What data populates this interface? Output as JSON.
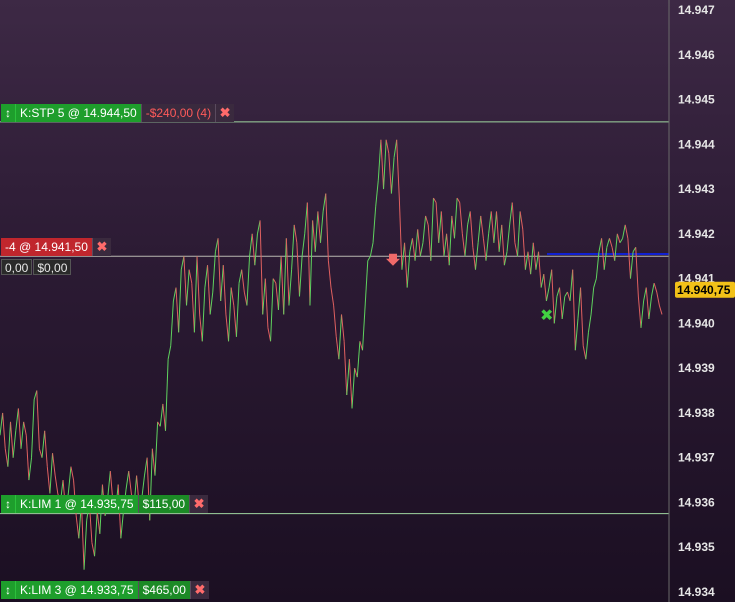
{
  "chart_data": {
    "type": "line",
    "y_axis": {
      "ylim": [
        14.9336,
        14.9473
      ],
      "ticks": [
        "14.947",
        "14.946",
        "14.945",
        "14.944",
        "14.943",
        "14.942",
        "14.941",
        "14.940",
        "14.939",
        "14.938",
        "14.937",
        "14.936",
        "14.935",
        "14.934"
      ]
    },
    "last_price": "14.940,75",
    "series": [
      {
        "values": [
          14.9375,
          14.938,
          14.9372,
          14.9368,
          14.9378,
          14.937,
          14.9376,
          14.9381,
          14.9372,
          14.9378,
          14.9375,
          14.9365,
          14.937,
          14.9383,
          14.9385,
          14.9372,
          14.937,
          14.9376,
          14.9368,
          14.9362,
          14.9371,
          14.9366,
          14.9362,
          14.936,
          14.9365,
          14.9358,
          14.9362,
          14.9368,
          14.9365,
          14.9357,
          14.9352,
          14.936,
          14.9345,
          14.9356,
          14.936,
          14.9351,
          14.9348,
          14.9358,
          14.9353,
          14.9364,
          14.9357,
          14.9361,
          14.9367,
          14.936,
          14.9358,
          14.9364,
          14.9352,
          14.9358,
          14.9363,
          14.9367,
          14.9362,
          14.9359,
          14.9366,
          14.9359,
          14.9361,
          14.9366,
          14.937,
          14.9356,
          14.9372,
          14.9366,
          14.9378,
          14.9377,
          14.9382,
          14.9376,
          14.9392,
          14.9395,
          14.9405,
          14.9408,
          14.9398,
          14.9412,
          14.9415,
          14.9404,
          14.9412,
          14.9409,
          14.9398,
          14.9415,
          14.9402,
          14.9396,
          14.9408,
          14.9413,
          14.9402,
          14.9407,
          14.9416,
          14.9419,
          14.9405,
          14.9413,
          14.9402,
          14.9396,
          14.9408,
          14.9404,
          14.9397,
          14.9409,
          14.9412,
          14.9407,
          14.9404,
          14.9415,
          14.942,
          14.9413,
          14.942,
          14.9423,
          14.9402,
          14.941,
          14.9399,
          14.9396,
          14.941,
          14.9409,
          14.9403,
          14.9415,
          14.9402,
          14.9419,
          14.9404,
          14.9412,
          14.9422,
          14.9418,
          14.9406,
          14.9415,
          14.942,
          14.9427,
          14.9404,
          14.9423,
          14.9416,
          14.9425,
          14.9418,
          14.9425,
          14.9429,
          14.9414,
          14.9408,
          14.9404,
          14.9397,
          14.9392,
          14.9402,
          14.9396,
          14.9384,
          14.9392,
          14.9381,
          14.939,
          14.9388,
          14.9396,
          14.9394,
          14.9404,
          14.9414,
          14.9415,
          14.9418,
          14.9426,
          14.9432,
          14.9441,
          14.943,
          14.9441,
          14.9438,
          14.9429,
          14.9437,
          14.9441,
          14.9428,
          14.9412,
          14.9418,
          14.9408,
          14.9416,
          14.9419,
          14.9414,
          14.9421,
          14.9415,
          14.9418,
          14.9424,
          14.9422,
          14.9414,
          14.9428,
          14.9427,
          14.9418,
          14.9425,
          14.9415,
          14.942,
          14.9413,
          14.9424,
          14.9419,
          14.9428,
          14.9427,
          14.942,
          14.9415,
          14.9422,
          14.9425,
          14.9417,
          14.9412,
          14.9418,
          14.9424,
          14.9419,
          14.9414,
          14.942,
          14.9425,
          14.9418,
          14.9425,
          14.9416,
          14.9422,
          14.9413,
          14.9416,
          14.9422,
          14.9427,
          14.9418,
          14.9415,
          14.9425,
          14.9421,
          14.9412,
          14.9416,
          14.9411,
          14.9418,
          14.9412,
          14.9416,
          14.9408,
          14.9411,
          14.9405,
          14.9408,
          14.9412,
          14.94,
          14.9406,
          14.9408,
          14.9401,
          14.9406,
          14.9407,
          14.9405,
          14.9412,
          14.9394,
          14.9401,
          14.9408,
          14.9395,
          14.9392,
          14.9398,
          14.9402,
          14.9408,
          14.941,
          14.9416,
          14.9419,
          14.9412,
          14.9417,
          14.9419,
          14.9417,
          14.9414,
          14.942,
          14.9418,
          14.9419,
          14.9422,
          14.9419,
          14.941,
          14.9416,
          14.9417,
          14.9406,
          14.9399,
          14.9405,
          14.9408,
          14.9401,
          14.9406,
          14.9409,
          14.9407,
          14.9404,
          14.9402
        ]
      }
    ],
    "annotations": {
      "current_level_line": 14.9415,
      "position_avg": 14.9415,
      "blue_segment": 14.94155,
      "sell_marker_value": 14.9414,
      "exit_marker_value": 14.9402
    }
  },
  "orders": [
    {
      "name": "stop",
      "label": "K:STP  5 @ 14.944,50",
      "pnl": "-$240,00 (4)",
      "value": 14.9445,
      "pnl_style": "neg"
    },
    {
      "name": "limit-1",
      "label": "K:LIM  1 @ 14.935,75",
      "pnl": "$115,00",
      "value": 14.93575,
      "pnl_style": "green"
    },
    {
      "name": "limit-3",
      "label": "K:LIM  3 @ 14.933,75",
      "pnl": "$465,00",
      "value": 14.93375,
      "pnl_style": "green"
    }
  ],
  "position": {
    "label": "-4 @ 14.941,50",
    "pnl_points": "0,00",
    "pnl_money": "$0,00"
  },
  "colors": {
    "up": "#5fd35f",
    "down": "#e06060",
    "order_line": "#9fd69f",
    "level_line": "#b8b8b0",
    "blue_line": "#1020d0",
    "price_badge": "#f2c118"
  }
}
